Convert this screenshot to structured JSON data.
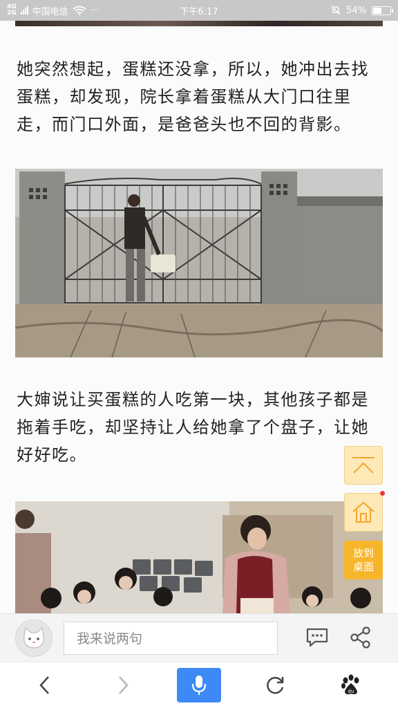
{
  "status_bar": {
    "network_top": "4G",
    "network_bottom": "2G",
    "carrier": "中国电信",
    "more": "···",
    "time": "下午6:17",
    "battery_text": "54%",
    "battery_level": 0.54
  },
  "article": {
    "paragraphs": [
      "她突然想起，蛋糕还没拿，所以，她冲出去找蛋糕，却发现，院长拿着蛋糕从大门口往里走，而门口外面，是爸爸头也不回的背影。",
      "大婶说让买蛋糕的人吃第一块，其他孩子都是拖着手吃，却坚持让人给她拿了个盘子，让她好好吃。"
    ]
  },
  "floating": {
    "to_top_icon": "scroll-to-top-icon",
    "home_icon": "home-icon",
    "desktop_label_line1": "放到",
    "desktop_label_line2": "桌面"
  },
  "comment_bar": {
    "avatar_icon": "cat-avatar-icon",
    "input_placeholder": "我来说两句",
    "comments_icon": "comment-bubble-icon",
    "share_icon": "share-icon"
  },
  "bottom_nav": {
    "back_icon": "chevron-left-icon",
    "forward_icon": "chevron-right-icon",
    "voice_icon": "microphone-icon",
    "refresh_icon": "refresh-icon",
    "baidu_icon": "baidu-paw-icon"
  },
  "colors": {
    "status_bar": "#c8c8c8",
    "voice_button": "#3d8af7",
    "desktop_button": "#f7b52a",
    "float_button": "#fde9b8"
  }
}
